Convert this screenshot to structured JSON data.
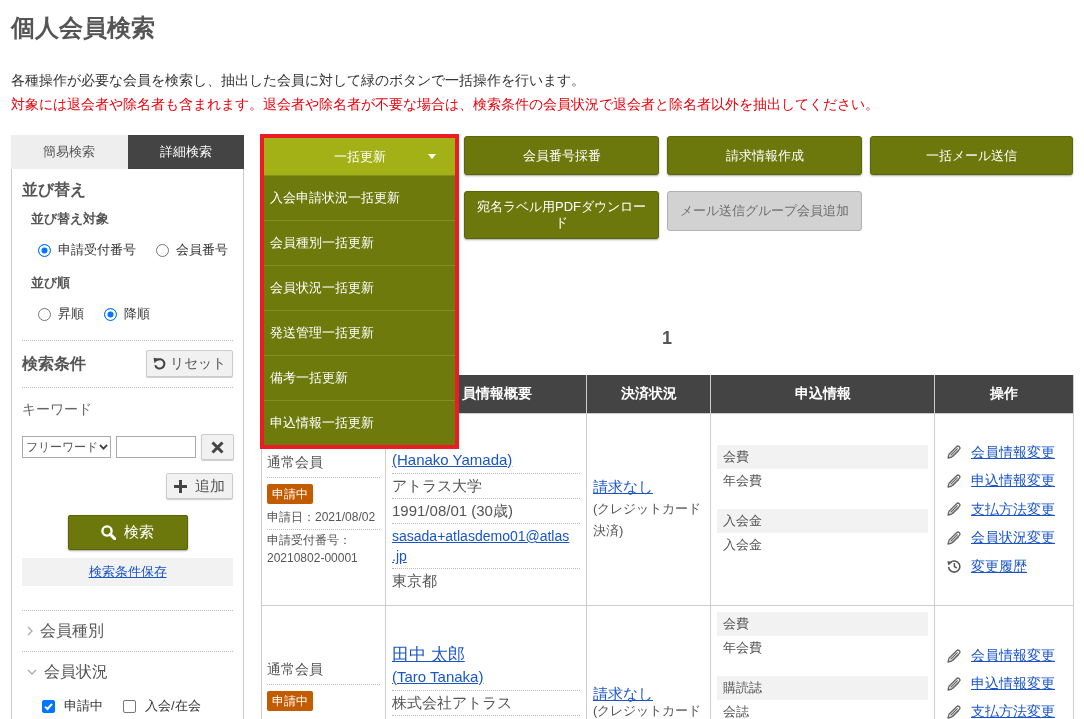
{
  "page": {
    "title": "個人会員検索",
    "description": "各種操作が必要な会員を検索し、抽出した会員に対して緑のボタンで一括操作を行います。",
    "warning": "対象には退会者や除名者も含まれます。退会者や除名者が不要な場合は、検索条件の会員状況で退会者と除名者以外を抽出してください。"
  },
  "sidebar": {
    "tabs": [
      {
        "label": "簡易検索",
        "selected": false
      },
      {
        "label": "詳細検索",
        "selected": true
      }
    ],
    "sort": {
      "heading": "並び替え",
      "groups": [
        {
          "label": "並び替え対象",
          "options": [
            {
              "label": "申請受付番号",
              "selected": true
            },
            {
              "label": "会員番号",
              "selected": false
            }
          ]
        },
        {
          "label": "並び順",
          "options": [
            {
              "label": "昇順",
              "selected": false
            },
            {
              "label": "降順",
              "selected": true
            }
          ]
        }
      ]
    },
    "conditions": {
      "heading": "検索条件",
      "reset_button": "リセット",
      "keyword_label": "キーワード",
      "keyword_select": "フリーワード",
      "add_button": "追加",
      "search_button": "検索",
      "save_link": "検索条件保存"
    },
    "filters": [
      {
        "label": "会員種別",
        "expanded": false
      },
      {
        "label": "会員状況",
        "expanded": true,
        "options": [
          {
            "label": "申請中",
            "checked": true
          },
          {
            "label": "入会/在会",
            "checked": false
          }
        ]
      }
    ]
  },
  "actions": {
    "bulk_update": {
      "label": "一括更新",
      "expanded": true,
      "items": [
        "入会申請状況一括更新",
        "会員種別一括更新",
        "会員状況一括更新",
        "発送管理一括更新",
        "備考一括更新",
        "申込情報一括更新"
      ]
    },
    "buttons": [
      {
        "label": "会員番号採番",
        "disabled": false
      },
      {
        "label": "請求情報作成",
        "disabled": false
      },
      {
        "label": "一括メール送信",
        "disabled": false
      },
      {
        "label": "宛名ラベル用PDFダウンロード",
        "disabled": false
      },
      {
        "label": "メール送信グループ会員追加",
        "disabled": true
      }
    ]
  },
  "pagination": {
    "current": "1"
  },
  "table": {
    "columns": [
      "員情報概要",
      "決済状況",
      "申込情報",
      "操作"
    ],
    "rows": [
      {
        "member_type": "通常会員",
        "status": "申請中",
        "applied_date": "申請日：2021/08/02",
        "receipt_label": "申請受付番号：",
        "receipt_number": "20210802-00001",
        "name_roman": "(Hanako Yamada)",
        "organization": "アトラス大学",
        "birth": "1991/08/01 (30歳)",
        "email": "sasada+atlasdemo01@atlas.jp",
        "address": "東京都",
        "payment": "請求なし",
        "payment_method": "(クレジットカード決済)",
        "applications": [
          {
            "label": "会費",
            "value": "年会費"
          },
          {
            "label": "入会金",
            "value": "入会金"
          }
        ],
        "operations": [
          {
            "kind": "edit",
            "label": "会員情報変更"
          },
          {
            "kind": "edit",
            "label": "申込情報変更"
          },
          {
            "kind": "edit",
            "label": "支払方法変更"
          },
          {
            "kind": "edit",
            "label": "会員状況変更"
          },
          {
            "kind": "history",
            "label": "変更履歴"
          }
        ]
      },
      {
        "member_type": "通常会員",
        "status": "申請中",
        "name": "田中 太郎",
        "name_roman": "(Taro Tanaka)",
        "organization": "株式会社アトラス",
        "payment": "請求なし",
        "payment_method": "(クレジットカード",
        "applications": [
          {
            "label": "会費",
            "value": "年会費"
          },
          {
            "label": "購読誌",
            "value": "会誌"
          }
        ],
        "operations": [
          {
            "kind": "edit",
            "label": "会員情報変更"
          },
          {
            "kind": "edit",
            "label": "申込情報変更"
          },
          {
            "kind": "edit",
            "label": "支払方法変更"
          }
        ]
      }
    ]
  }
}
